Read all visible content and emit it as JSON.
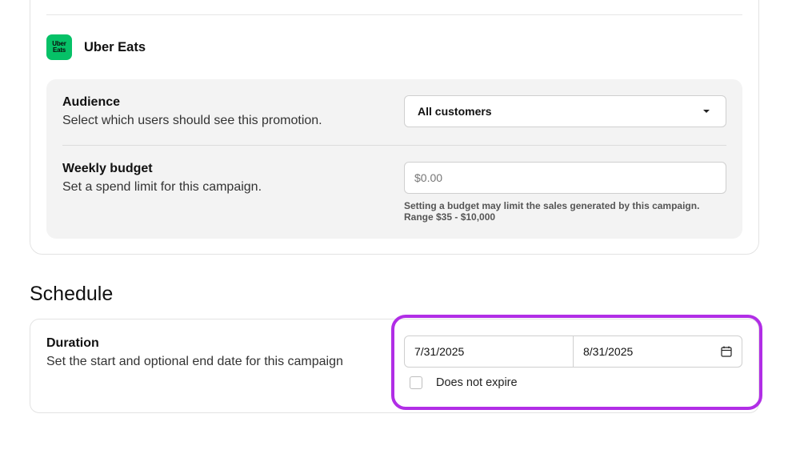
{
  "provider": {
    "logo_line1": "Uber",
    "logo_line2": "Eats",
    "name": "Uber Eats",
    "brand_color": "#06c167"
  },
  "audience": {
    "title": "Audience",
    "description": "Select which users should see this promotion.",
    "selected": "All customers"
  },
  "weekly_budget": {
    "title": "Weekly budget",
    "description": "Set a spend limit for this campaign.",
    "placeholder": "$0.00",
    "helper_line1": "Setting a budget may limit the sales generated by this campaign.",
    "helper_line2": "Range $35 - $10,000"
  },
  "schedule": {
    "section_title": "Schedule",
    "duration_title": "Duration",
    "duration_description": "Set the start and optional end date for this campaign",
    "start_date": "7/31/2025",
    "end_date": "8/31/2025",
    "no_expire_label": "Does not expire",
    "no_expire_checked": false,
    "highlight_color": "#b12ee6"
  }
}
